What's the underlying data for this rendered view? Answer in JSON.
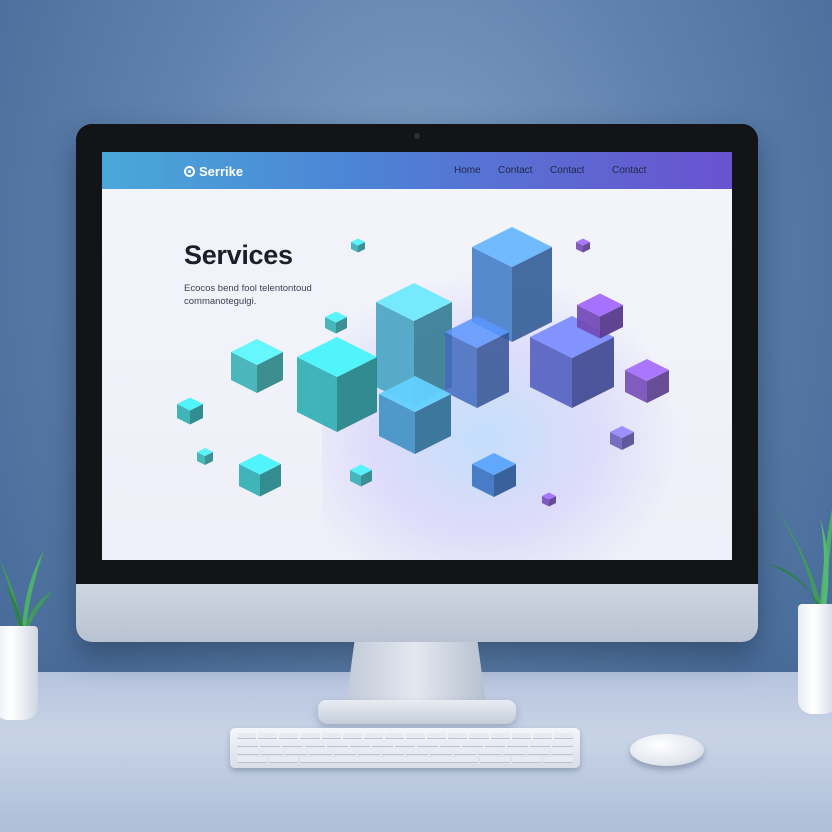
{
  "site": {
    "brand": "Serrike",
    "nav": [
      "Home",
      "Contact",
      "Contact",
      "Contact"
    ]
  },
  "hero": {
    "title": "Services",
    "subtitle_line1": "Ecocos bend fool telentontoud",
    "subtitle_line2": "commanotegulgi."
  },
  "colors": {
    "nav_gradient_start": "#4aa8d8",
    "nav_gradient_end": "#6a52cf",
    "cube_teal": "#3fd0d6",
    "cube_blue": "#4d8ce6",
    "cube_violet": "#8a5ad8"
  },
  "icons": {
    "logo": "circle-logo-icon",
    "decor": "isometric-cubes"
  }
}
